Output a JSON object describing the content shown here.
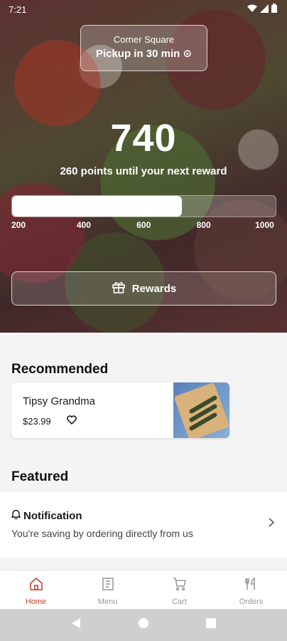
{
  "status_bar": {
    "time": "7:21"
  },
  "store": {
    "name": "Corner Square",
    "pickup": "Pickup in 30 min ⊙"
  },
  "rewards": {
    "points": "740",
    "message": "260 points until your next reward",
    "progress_fraction": 0.645,
    "ticks": [
      "200",
      "400",
      "600",
      "800",
      "1000"
    ],
    "button_label": "Rewards"
  },
  "recommended": {
    "title": "Recommended",
    "item": {
      "name": "Tipsy Grandma",
      "price": "$23.99"
    }
  },
  "featured": {
    "title": "Featured",
    "notification": {
      "title": "Notification",
      "text": "You're saving by ordering directly from us"
    }
  },
  "nav": {
    "items": [
      {
        "label": "Home",
        "icon": "home-icon",
        "active": true
      },
      {
        "label": "Menu",
        "icon": "menu-icon",
        "active": false
      },
      {
        "label": "Cart",
        "icon": "cart-icon",
        "active": false
      },
      {
        "label": "Orders",
        "icon": "orders-icon",
        "active": false
      }
    ]
  },
  "colors": {
    "accent": "#c4442c",
    "nav_inactive": "#999999"
  }
}
